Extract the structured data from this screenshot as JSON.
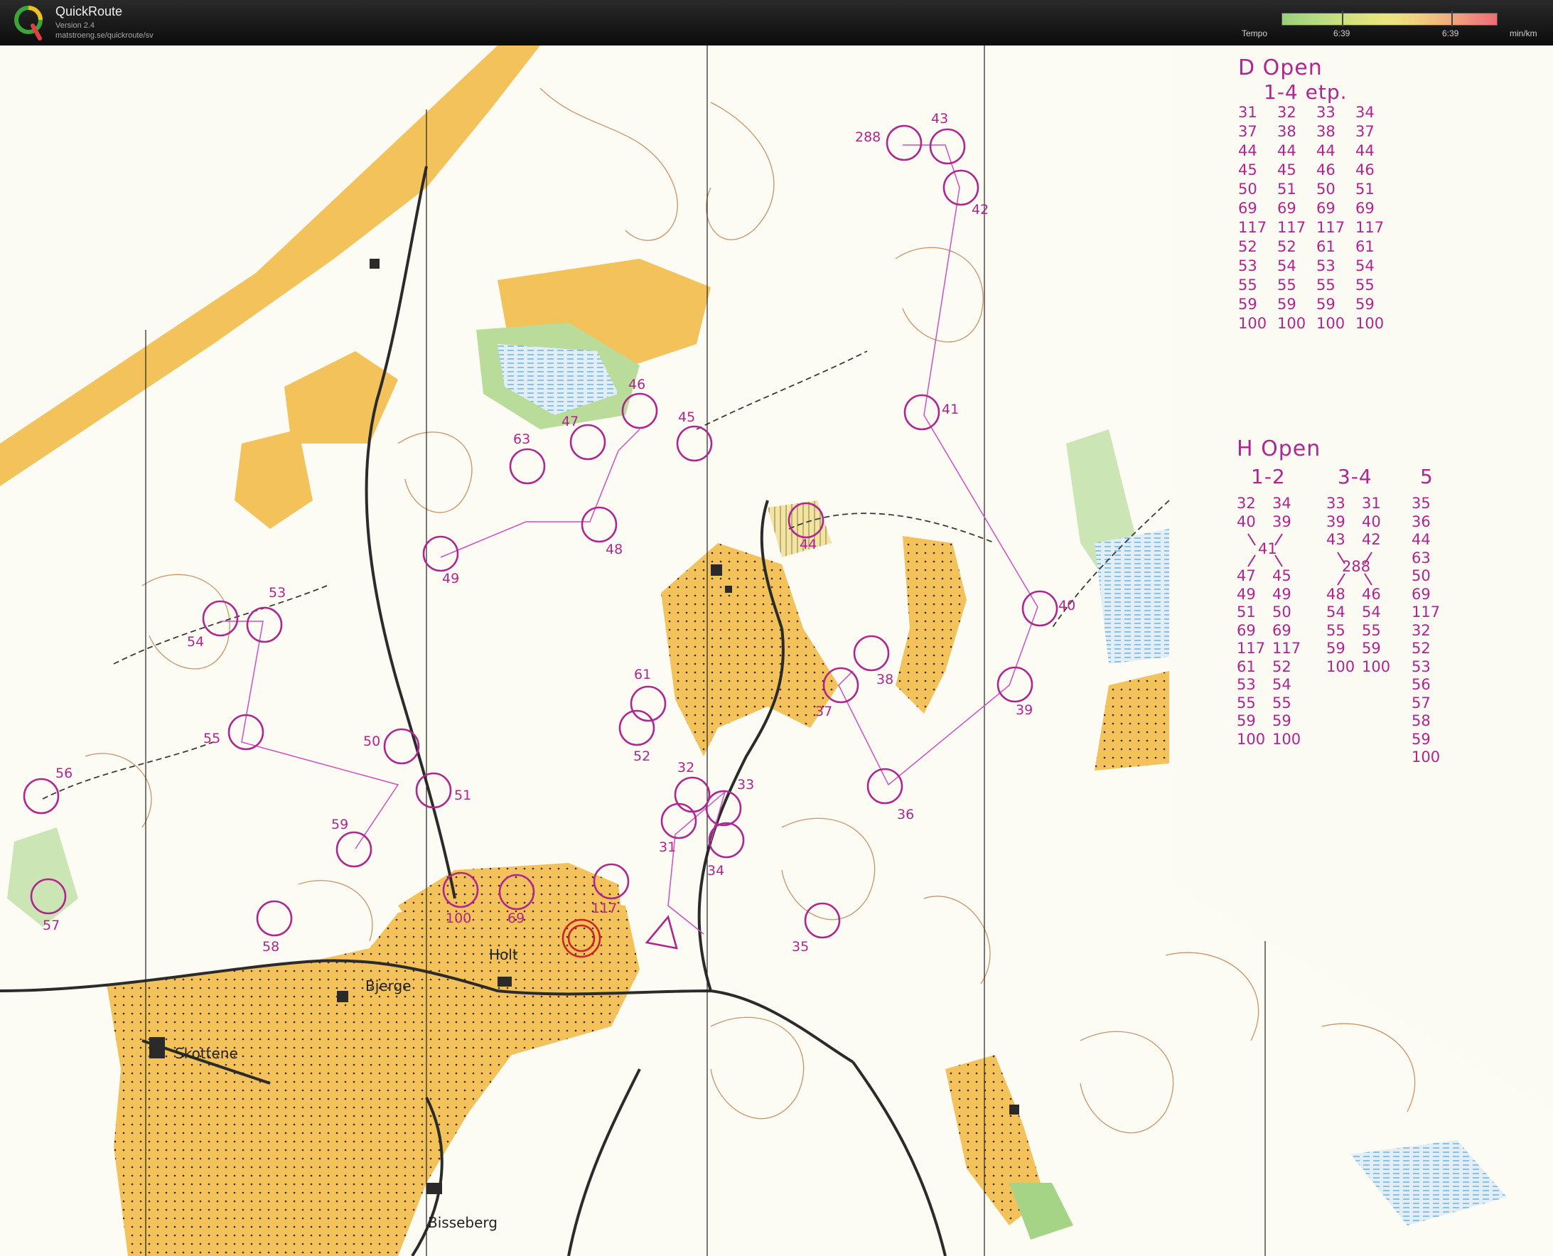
{
  "header": {
    "app_name": "QuickRoute",
    "version": "Version 2.4",
    "url": "matstroeng.se/quickroute/sv",
    "tempo_label": "Tempo",
    "tempo_mid_value": "6:39",
    "tempo_right_value": "6:39",
    "unit": "min/km",
    "colors": {
      "bar_start": "#9ad07a",
      "bar_end": "#ec6e74"
    }
  },
  "map": {
    "places": [
      "Holt",
      "Bjerge",
      "Skottene",
      "Bisseberg"
    ],
    "controls": [
      "288",
      "43",
      "42",
      "41",
      "46",
      "47",
      "45",
      "63",
      "48",
      "44",
      "49",
      "53",
      "54",
      "40",
      "38",
      "37",
      "39",
      "61",
      "52",
      "55",
      "50",
      "32",
      "33",
      "36",
      "51",
      "56",
      "59",
      "31",
      "34",
      "117",
      "57",
      "100",
      "69",
      "58",
      "35"
    ],
    "colors": {
      "course": "#b0258f",
      "open_land": "#f3c25a",
      "rough_open": "#f7dc94",
      "green": "#a6d487",
      "marsh": "#9cc7e6",
      "roads": "#2b2b2b",
      "contours": "#b57038"
    }
  },
  "legend_d": {
    "title": "D Open",
    "subtitle": "1-4 etp.",
    "rows": [
      [
        "31",
        "32",
        "33",
        "34"
      ],
      [
        "37",
        "38",
        "38",
        "37"
      ],
      [
        "44",
        "44",
        "44",
        "44"
      ],
      [
        "45",
        "45",
        "46",
        "46"
      ],
      [
        "50",
        "51",
        "50",
        "51"
      ],
      [
        "69",
        "69",
        "69",
        "69"
      ],
      [
        "117",
        "117",
        "117",
        "117"
      ],
      [
        "52",
        "52",
        "61",
        "61"
      ],
      [
        "53",
        "54",
        "53",
        "54"
      ],
      [
        "55",
        "55",
        "55",
        "55"
      ],
      [
        "59",
        "59",
        "59",
        "59"
      ],
      [
        "100",
        "100",
        "100",
        "100"
      ]
    ]
  },
  "legend_h": {
    "title": "H Open",
    "col1_head": "1-2",
    "col2_head": "3-4",
    "col3_head": "5",
    "col1_top": [
      "32",
      "34",
      "40",
      "39"
    ],
    "col1_mid": "41",
    "col1_bottom": [
      [
        "47",
        "45"
      ],
      [
        "49",
        "49"
      ],
      [
        "51",
        "50"
      ],
      [
        "69",
        "69"
      ],
      [
        "117",
        "117"
      ],
      [
        "61",
        "52"
      ],
      [
        "53",
        "54"
      ],
      [
        "55",
        "55"
      ],
      [
        "59",
        "59"
      ],
      [
        "100",
        "100"
      ]
    ],
    "col2_top": [
      "33",
      "31",
      "39",
      "40",
      "43",
      "42"
    ],
    "col2_mid": "288",
    "col2_bottom": [
      [
        "48",
        "46"
      ],
      [
        "54",
        "54"
      ],
      [
        "55",
        "55"
      ],
      [
        "59",
        "59"
      ],
      [
        "100",
        "100"
      ]
    ],
    "col3": [
      "35",
      "36",
      "44",
      "63",
      "50",
      "69",
      "117",
      "32",
      "52",
      "53",
      "56",
      "57",
      "58",
      "59",
      "100"
    ]
  }
}
